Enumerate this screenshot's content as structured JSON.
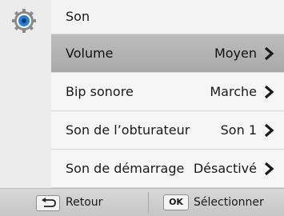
{
  "header": {
    "title": "Son"
  },
  "items": [
    {
      "label": "Volume",
      "value": "Moyen"
    },
    {
      "label": "Bip sonore",
      "value": "Marche"
    },
    {
      "label": "Son de l’obturateur",
      "value": "Son 1"
    },
    {
      "label": "Son de démarrage",
      "value": "Désactivé"
    }
  ],
  "footer": {
    "back_label": "Retour",
    "ok_key": "OK",
    "select_label": "Sélectionner"
  },
  "icons": {
    "settings": "gear-icon",
    "chevron": "chevron-right-icon",
    "back": "back-arrow-icon"
  }
}
